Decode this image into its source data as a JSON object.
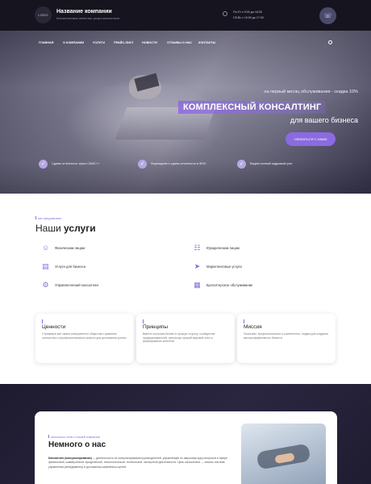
{
  "header": {
    "logo": "LOGO",
    "company": "Название компании",
    "tagline": "Консалтинговое агентство: услуги консалтинга",
    "hours": [
      "Пн-Пт с 9:00 до 18:00",
      "Сб-Вс с 10:00 до 17:00"
    ],
    "phone_icon": "phone-icon"
  },
  "nav": {
    "items": [
      "ГЛАВНАЯ",
      "О КОМПАНИИ",
      "УСЛУГИ",
      "ПРАЙС-ЛИСТ",
      "НОВОСТИ",
      "ОТЗЫВЫ О НАС",
      "КОНТАКТЫ"
    ]
  },
  "hero": {
    "promo": "на первый месяц обслуживания - скидка 10%",
    "headline": "КОМПЛЕКСНЫЙ КОНСАЛТИНГ",
    "subline": "для вашего бизнеса",
    "cta": "СВЯЗАТЬСЯ С НАМИ",
    "features": [
      "Сдаем отчетность через СБИС++",
      "Формируем и сдаем отчетность в ФНС",
      "Ведем полный кадровый учет"
    ]
  },
  "services": {
    "tag": "мы предлагаем",
    "title_light": "Наши",
    "title_bold": "услуги",
    "items": [
      {
        "label": "Физическим лицам",
        "icon": "user-icon"
      },
      {
        "label": "Юридическим лицам",
        "icon": "briefcase-icon"
      },
      {
        "label": "Услуги для бизнеса",
        "icon": "chart-icon"
      },
      {
        "label": "Маркетинговые услуги",
        "icon": "megaphone-icon"
      },
      {
        "label": "Управленческий консалтинг",
        "icon": "gear-icon"
      },
      {
        "label": "Бухгалтерское обслуживание",
        "icon": "calculator-icon"
      }
    ]
  },
  "cards": [
    {
      "title": "Ценности",
      "text": "Стремимся всё своим совершенного общества к развитию личностных и профессиональных качеств для достижения успеха"
    },
    {
      "title": "Принципы",
      "text": "Вместе построим бизнес в лучшую сторону, сообщества предпринимателей, используя лучший мировой опыт и формирования клиентов"
    },
    {
      "title": "Миссия",
      "text": "Помогаем, профессионально и компетентно, людям для создания высокоэффективного бизнеса"
    }
  ],
  "about": {
    "tag": "несколько слов о нашей компании",
    "title": "Немного о нас",
    "body_bold": "Консалтинг (консультирование)",
    "body": " — деятельность по консультированию руководителей, управленцев по широкому кругу вопросов в сфере финансовой, коммерческой, юридической, технологической, технической, экспертной деятельности. Цель консалтинга — помочь системе управления (менеджменту) в достижении заявленных целей."
  }
}
